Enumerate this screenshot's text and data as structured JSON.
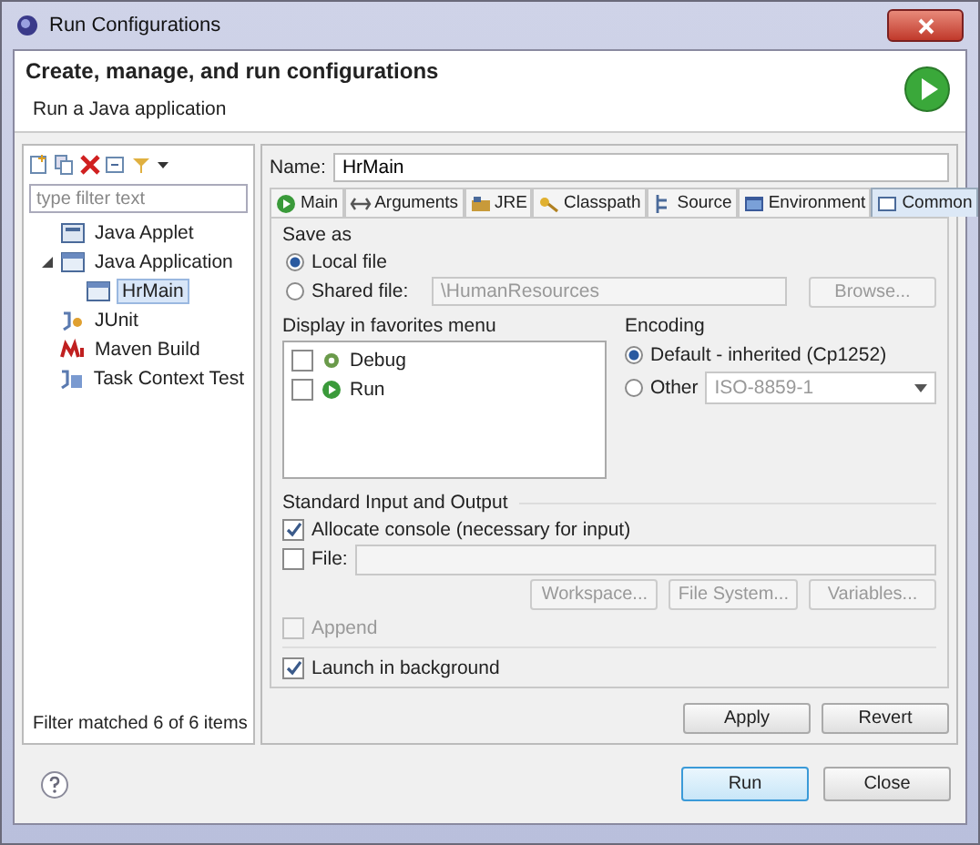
{
  "window": {
    "title": "Run Configurations"
  },
  "header": {
    "title": "Create, manage, and run configurations",
    "subtitle": "Run a Java application"
  },
  "filter": {
    "placeholder": "type filter text"
  },
  "tree": [
    {
      "label": "Java Applet",
      "kind": "applet"
    },
    {
      "label": "Java Application",
      "kind": "application",
      "expanded": true,
      "children": [
        {
          "label": "HrMain",
          "kind": "config",
          "selected": true
        }
      ]
    },
    {
      "label": "JUnit",
      "kind": "junit"
    },
    {
      "label": "Maven Build",
      "kind": "maven"
    },
    {
      "label": "Task Context Test",
      "kind": "task"
    }
  ],
  "filter_status": "Filter matched 6 of 6 items",
  "name": {
    "label": "Name:",
    "value": "HrMain"
  },
  "tabs": [
    {
      "label": "Main",
      "kind": "main",
      "selected": false
    },
    {
      "label": "Arguments",
      "kind": "arguments",
      "selected": false
    },
    {
      "label": "JRE",
      "kind": "jre",
      "selected": false
    },
    {
      "label": "Classpath",
      "kind": "classpath",
      "selected": false
    },
    {
      "label": "Source",
      "kind": "source",
      "selected": false
    },
    {
      "label": "Environment",
      "kind": "environment",
      "selected": false
    },
    {
      "label": "Common",
      "kind": "common",
      "selected": true
    }
  ],
  "save_as": {
    "title": "Save as",
    "options": [
      {
        "label": "Local file",
        "selected": true
      },
      {
        "label": "Shared file:",
        "selected": false
      }
    ],
    "shared_value": "\\HumanResources",
    "browse": {
      "label": "Browse...",
      "disabled": true
    }
  },
  "favorites": {
    "title": "Display in favorites menu",
    "items": [
      {
        "label": "Debug",
        "kind": "debug",
        "checked": false
      },
      {
        "label": "Run",
        "kind": "run",
        "checked": false
      }
    ]
  },
  "encoding": {
    "title": "Encoding",
    "options": [
      {
        "label": "Default - inherited (Cp1252)",
        "selected": true
      },
      {
        "label": "Other",
        "selected": false
      }
    ],
    "other_value": "ISO-8859-1"
  },
  "io": {
    "title": "Standard Input and Output",
    "allocate_console": {
      "label": "Allocate console (necessary for input)",
      "checked": true
    },
    "file": {
      "label": "File:",
      "checked": false
    },
    "buttons": [
      {
        "label": "Workspace...",
        "disabled": true
      },
      {
        "label": "File System...",
        "disabled": true
      },
      {
        "label": "Variables...",
        "disabled": true
      }
    ],
    "append": {
      "label": "Append",
      "checked": false,
      "disabled": true
    }
  },
  "launch_background": {
    "label": "Launch in background",
    "checked": true
  },
  "panel_buttons": [
    {
      "label": "Apply"
    },
    {
      "label": "Revert"
    }
  ],
  "dialog_buttons": [
    {
      "label": "Run",
      "default": true
    },
    {
      "label": "Close",
      "default": false
    }
  ]
}
